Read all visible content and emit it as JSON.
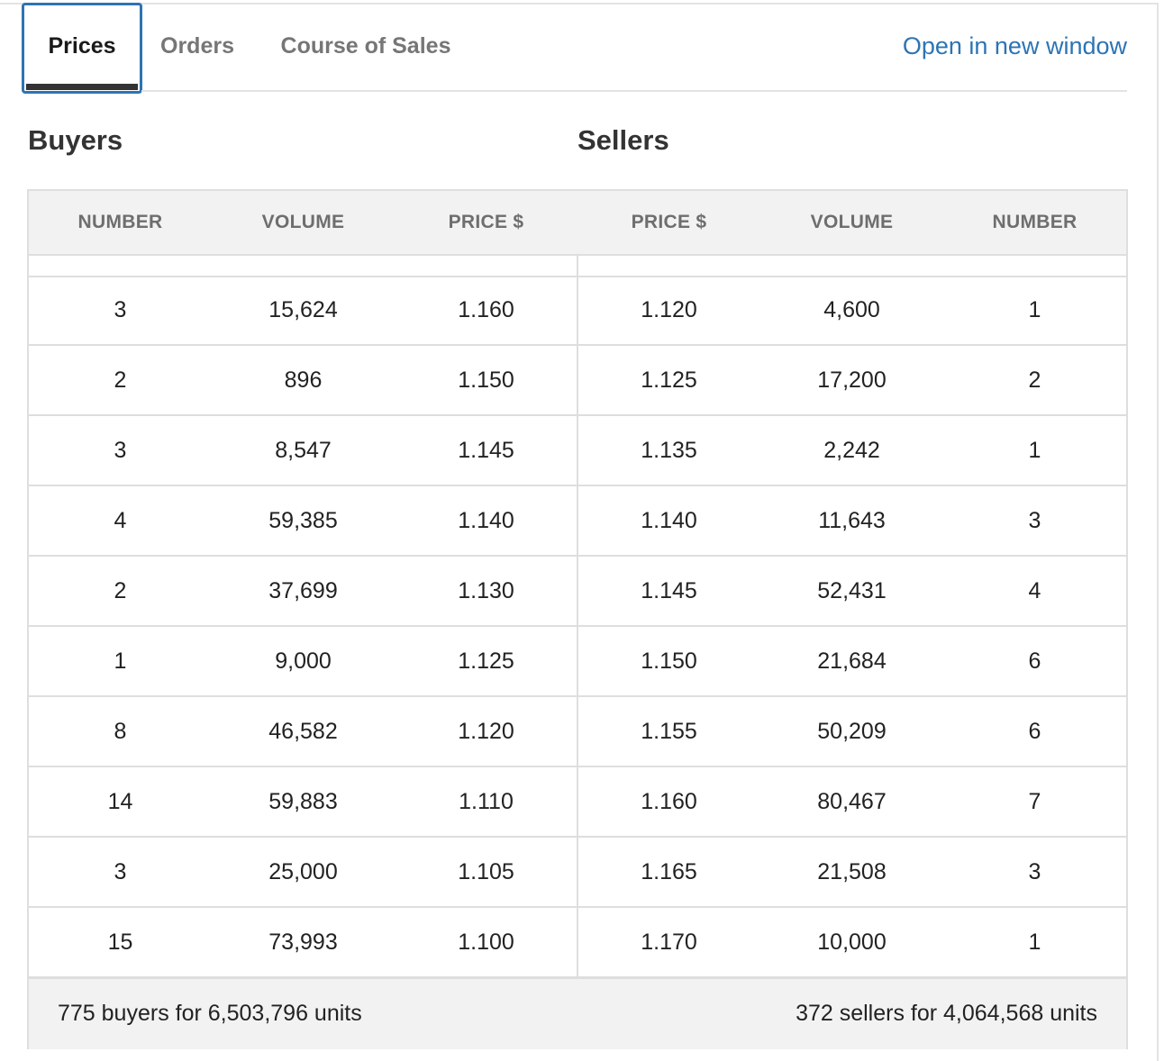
{
  "tabs": [
    {
      "label": "Prices",
      "active": true
    },
    {
      "label": "Orders",
      "active": false
    },
    {
      "label": "Course of Sales",
      "active": false
    }
  ],
  "open_new_window": "Open in new window",
  "buyers_title": "Buyers",
  "sellers_title": "Sellers",
  "columns": [
    "NUMBER",
    "VOLUME",
    "PRICE $",
    "PRICE $",
    "VOLUME",
    "NUMBER"
  ],
  "rows": [
    [
      "3",
      "15,624",
      "1.160",
      "1.120",
      "4,600",
      "1"
    ],
    [
      "2",
      "896",
      "1.150",
      "1.125",
      "17,200",
      "2"
    ],
    [
      "3",
      "8,547",
      "1.145",
      "1.135",
      "2,242",
      "1"
    ],
    [
      "4",
      "59,385",
      "1.140",
      "1.140",
      "11,643",
      "3"
    ],
    [
      "2",
      "37,699",
      "1.130",
      "1.145",
      "52,431",
      "4"
    ],
    [
      "1",
      "9,000",
      "1.125",
      "1.150",
      "21,684",
      "6"
    ],
    [
      "8",
      "46,582",
      "1.120",
      "1.155",
      "50,209",
      "6"
    ],
    [
      "14",
      "59,883",
      "1.110",
      "1.160",
      "80,467",
      "7"
    ],
    [
      "3",
      "25,000",
      "1.105",
      "1.165",
      "21,508",
      "3"
    ],
    [
      "15",
      "73,993",
      "1.100",
      "1.170",
      "10,000",
      "1"
    ]
  ],
  "footer": {
    "buyers_summary": "775 buyers for 6,503,796 units",
    "sellers_summary": "372 sellers for 4,064,568 units"
  },
  "colors": {
    "accent": "#2d74b3",
    "header_bg": "#f2f2f2",
    "border": "#dedede"
  }
}
